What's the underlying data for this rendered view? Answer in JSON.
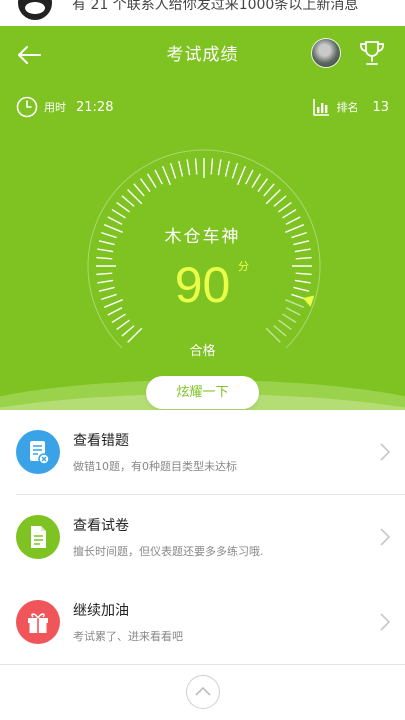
{
  "notification": {
    "text": "有 21 个联系人给你发过来1000条以上新消息"
  },
  "header": {
    "title": "考试成绩"
  },
  "stats": {
    "time_label": "用时",
    "time_value": "21:28",
    "rank_label": "排名",
    "rank_value": "13"
  },
  "result": {
    "player_name": "木仓车神",
    "score": "90",
    "unit": "分",
    "grade": "合格",
    "show_button": "炫耀一下",
    "score_fraction": 0.9
  },
  "menu": [
    {
      "title": "查看错题",
      "subtitle": "做错10题，有0种题目类型未达标",
      "icon": "wrong-questions-icon",
      "color": "#3aa3e8"
    },
    {
      "title": "查看试卷",
      "subtitle": "擅长时间题，但仪表题还要多多练习哦.",
      "icon": "document-icon",
      "color": "#7ec322"
    },
    {
      "title": "继续加油",
      "subtitle": "考试累了、进来看看吧",
      "icon": "gift-icon",
      "color": "#f0555a"
    }
  ],
  "colors": {
    "accent": "#7ec322",
    "score": "#e9ff4a"
  }
}
